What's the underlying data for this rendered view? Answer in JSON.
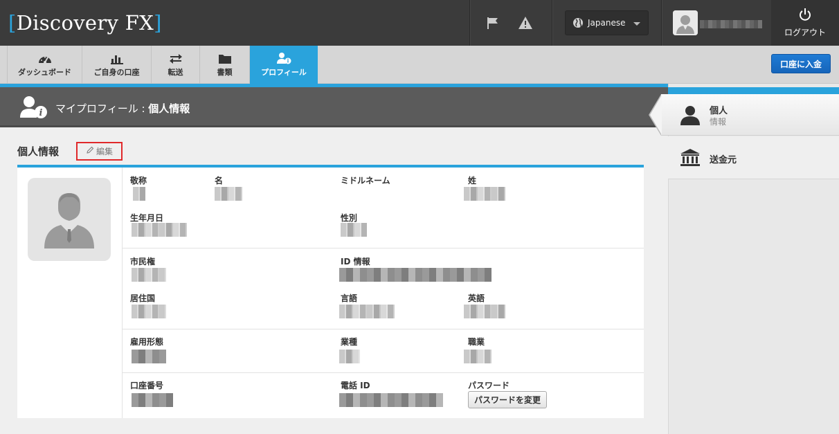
{
  "header": {
    "logo_text": "Discovery FX",
    "language": "Japanese",
    "logout_label": "ログアウト"
  },
  "nav": {
    "tabs": [
      {
        "label": "ダッシュボード",
        "icon": "dashboard-icon"
      },
      {
        "label": "ご自身の口座",
        "icon": "bar-chart-icon"
      },
      {
        "label": "転送",
        "icon": "transfer-arrows-icon"
      },
      {
        "label": "書類",
        "icon": "folder-icon"
      },
      {
        "label": "プロフィール",
        "icon": "user-info-icon",
        "active": true
      }
    ],
    "deposit_label": "口座に入金"
  },
  "title": {
    "prefix": "マイプロフィール : ",
    "current": "個人情報"
  },
  "section": {
    "title": "個人情報",
    "edit_label": "編集"
  },
  "fields": {
    "salutation": {
      "label": "敬称",
      "value": ""
    },
    "first_name": {
      "label": "名",
      "value": ""
    },
    "middle_name": {
      "label": "ミドルネーム",
      "value": ""
    },
    "last_name": {
      "label": "姓",
      "value": ""
    },
    "birth_date": {
      "label": "生年月日",
      "value": ""
    },
    "gender": {
      "label": "性別",
      "value": ""
    },
    "citizenship": {
      "label": "市民権",
      "value": ""
    },
    "id_info": {
      "label": "ID 情報",
      "value": ""
    },
    "residence": {
      "label": "居住国",
      "value": ""
    },
    "language": {
      "label": "言語",
      "value": ""
    },
    "english": {
      "label": "英語",
      "value": ""
    },
    "employment": {
      "label": "雇用形態",
      "value": ""
    },
    "industry": {
      "label": "業種",
      "value": ""
    },
    "occupation": {
      "label": "職業",
      "value": ""
    },
    "account_number": {
      "label": "口座番号",
      "value": ""
    },
    "phone_id": {
      "label": "電話 ID",
      "value": ""
    },
    "password": {
      "label": "パスワード"
    }
  },
  "password_button": "パスワードを変更",
  "sidebar": {
    "items": [
      {
        "label": "個人",
        "sub": "情報",
        "icon": "person-icon",
        "active": true
      },
      {
        "label": "送金元",
        "icon": "bank-icon"
      }
    ]
  },
  "colors": {
    "accent": "#2aa3dc",
    "topbar": "#3b3b3b",
    "deposit_button": "#1665bb",
    "edit_highlight": "#e0282a"
  }
}
